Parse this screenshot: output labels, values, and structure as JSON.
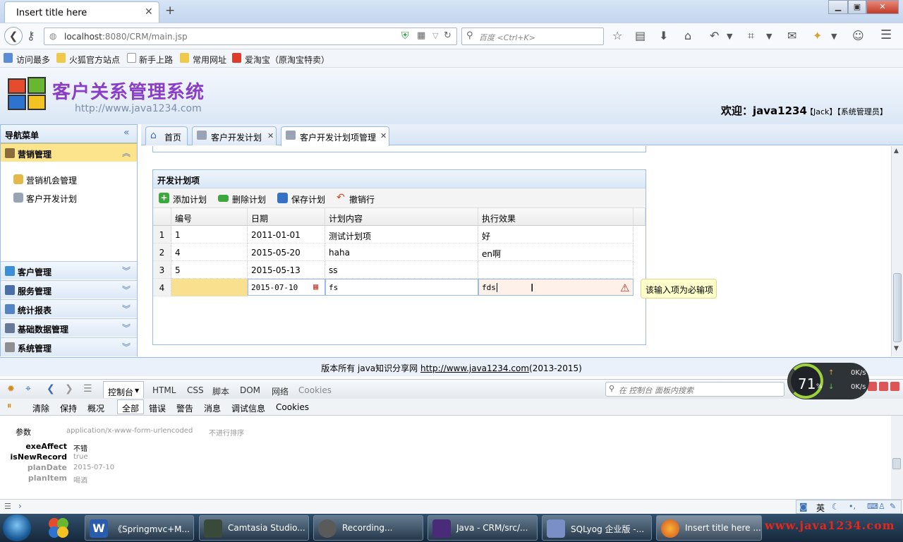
{
  "browser": {
    "tab_title": "Insert title here",
    "url_host": "localhost",
    "url_rest": ":8080/CRM/main.jsp",
    "search_placeholder": "百度 <Ctrl+K>"
  },
  "bookmarks": [
    "访问最多",
    "火狐官方站点",
    "新手上路",
    "常用网址",
    "爱淘宝（原淘宝特卖）"
  ],
  "app": {
    "title": "客户关系管理系统",
    "subtitle": "http://www.java1234.com",
    "welcome": "欢迎：java1234",
    "user_extra": "【Jack】【系统管理员】"
  },
  "leftnav": {
    "header": "导航菜单",
    "active_section": "营销管理",
    "sub_items": [
      "营销机会管理",
      "客户开发计划"
    ],
    "sections": [
      "客户管理",
      "服务管理",
      "统计报表",
      "基础数据管理",
      "系统管理"
    ]
  },
  "tabs": [
    {
      "label": "首页"
    },
    {
      "label": "客户开发计划"
    },
    {
      "label": "客户开发计划项管理"
    }
  ],
  "panel": {
    "title": "开发计划项",
    "toolbar": [
      "添加计划",
      "删除计划",
      "保存计划",
      "撤销行"
    ],
    "columns": [
      "编号",
      "日期",
      "计划内容",
      "执行效果"
    ],
    "rows": [
      {
        "n": "1",
        "id": "1",
        "date": "2011-01-01",
        "content": "测试计划项",
        "effect": "好"
      },
      {
        "n": "2",
        "id": "4",
        "date": "2015-05-20",
        "content": "haha",
        "effect": "en啊"
      },
      {
        "n": "3",
        "id": "5",
        "date": "2015-05-13",
        "content": "ss",
        "effect": ""
      }
    ],
    "edit_row": {
      "n": "4",
      "date": "2015-07-10",
      "content": "fs",
      "effect": "fds"
    },
    "tooltip": "该输入项为必输项"
  },
  "footer": {
    "prefix": "版本所有 java知识分享网 ",
    "link": "http://www.java1234.com",
    "suffix": "(2013-2015)"
  },
  "speed": {
    "percent": "71",
    "unit": "%",
    "up": "0K/s",
    "down": "0K/s"
  },
  "devtools": {
    "tabs": [
      "控制台",
      "HTML",
      "CSS",
      "脚本",
      "DOM",
      "网络",
      "Cookies"
    ],
    "search_placeholder": "在 控制台 面板内搜索",
    "buttons": [
      "清除",
      "保持",
      "概况",
      "全部",
      "错误",
      "警告",
      "消息",
      "调试信息",
      "Cookies"
    ],
    "params_label": "参数",
    "content_type": "application/x-www-form-urlencoded",
    "no_sort": "不进行排序",
    "params": [
      {
        "k": "exeAffect",
        "v": "不错"
      },
      {
        "k": "isNewRecord",
        "v": "true"
      },
      {
        "k": "planDate",
        "v": "2015-07-10"
      },
      {
        "k": "planItem",
        "v": "喝酒"
      }
    ]
  },
  "taskbar": [
    "《Springmvc+M...",
    "Camtasia Studio...",
    "Recording...",
    "Java - CRM/src/...",
    "SQLyog 企业版 -...",
    "Insert title here ..."
  ],
  "tray_lang": "英",
  "watermark": "www.java1234.com"
}
